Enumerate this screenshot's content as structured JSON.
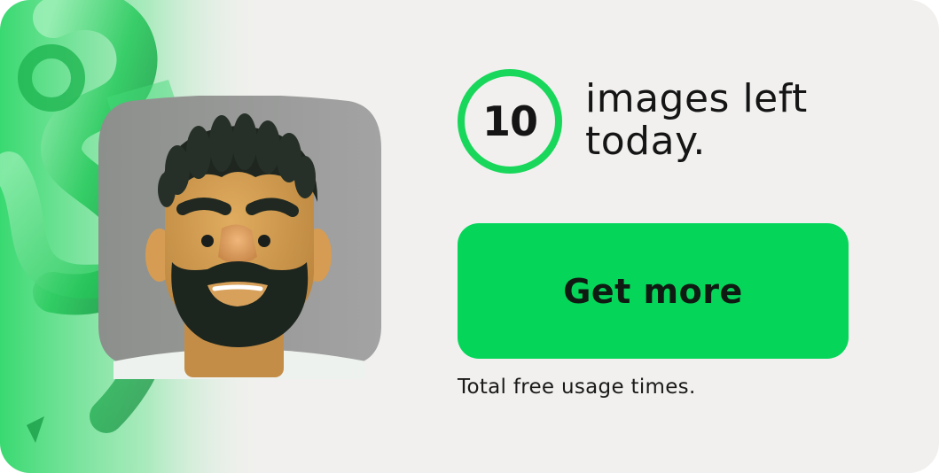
{
  "promo": {
    "remaining_count": "10",
    "headline_line1": "images left",
    "headline_line2": "today.",
    "cta_label": "Get more",
    "footnote": "Total free usage times."
  },
  "colors": {
    "card_background": "#f1f0ee",
    "accent_green": "#05d65a",
    "ring_green": "#19d75a",
    "text_dark": "#151515"
  },
  "icons": {
    "decoration": "green-3d-shape-icon",
    "avatar": "bearded-man-avatar"
  }
}
